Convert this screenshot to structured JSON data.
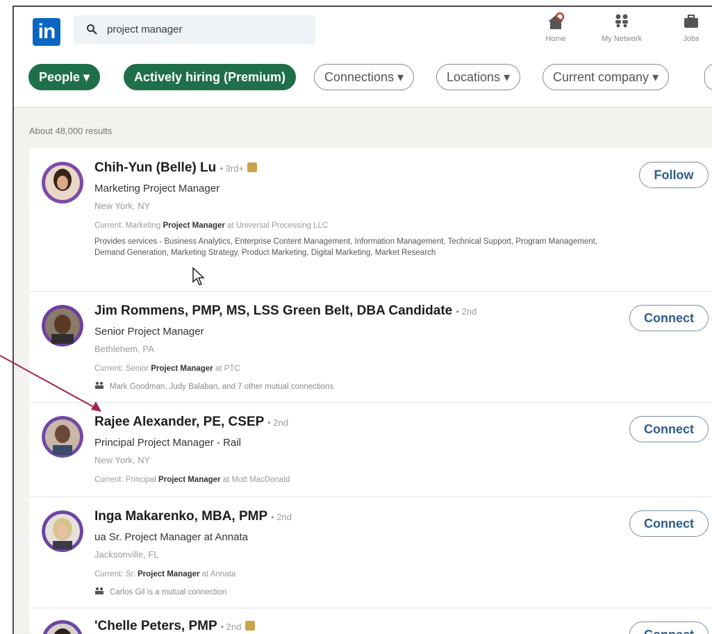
{
  "header": {
    "logo_text": "in",
    "search": {
      "value": "project manager"
    },
    "nav": [
      {
        "label": "Home",
        "icon": "home-icon"
      },
      {
        "label": "My Network",
        "icon": "network-icon"
      },
      {
        "label": "Jobs",
        "icon": "briefcase-icon"
      }
    ]
  },
  "filters": [
    "People",
    "Actively hiring (Premium)",
    "Connections",
    "Locations",
    "Current company"
  ],
  "results_count": "About 48,000 results",
  "results": [
    {
      "name": "Chih-Yun (Belle) Lu",
      "degree": "• 3rd+",
      "headline": "Marketing Project Manager",
      "location": "New York, NY",
      "current_prefix": "Current: Marketing",
      "current_bold": "Project Manager",
      "current_suffix": "at Universal Processing LLC",
      "services": "Provides services - Business Analytics, Enterprise Content Management, Information Management, Technical Support, Program Management, Demand Generation, Marketing Strategy, Product Marketing, Digital Marketing, Market Research",
      "action": "Follow"
    },
    {
      "name": "Jim Rommens, PMP, MS, LSS Green Belt, DBA Candidate",
      "degree": "• 2nd",
      "headline": "Senior Project Manager",
      "location": "Bethlehem, PA",
      "current_prefix": "Current: Senior",
      "current_bold": "Project Manager",
      "current_suffix": "at PTC",
      "mutual": "Mark Goodman, Judy Balaban, and 7 other mutual connections",
      "action": "Connect"
    },
    {
      "name": "Rajee Alexander, PE, CSEP",
      "degree": "• 2nd",
      "headline": "Principal Project Manager - Rail",
      "location": "New York, NY",
      "current_prefix": "Current: Principal",
      "current_bold": "Project Manager",
      "current_suffix": "at Mott MacDonald",
      "action": "Connect"
    },
    {
      "name": "Inga Makarenko, MBA, PMP",
      "degree": "• 2nd",
      "headline": "ua Sr. Project Manager at Annata",
      "location": "Jacksonville, FL",
      "current_prefix": "Current: Sr.",
      "current_bold": "Project Manager",
      "current_suffix": "at Annata",
      "mutual": "Carlos Gil is a mutual connection",
      "action": "Connect"
    },
    {
      "name": "'Chelle Peters, PMP",
      "degree": "• 2nd",
      "action": "Connect"
    }
  ],
  "colors": {
    "brand": "#0a66c2",
    "filter_active": "#1f6f4a",
    "arrow": "#a3264a"
  }
}
